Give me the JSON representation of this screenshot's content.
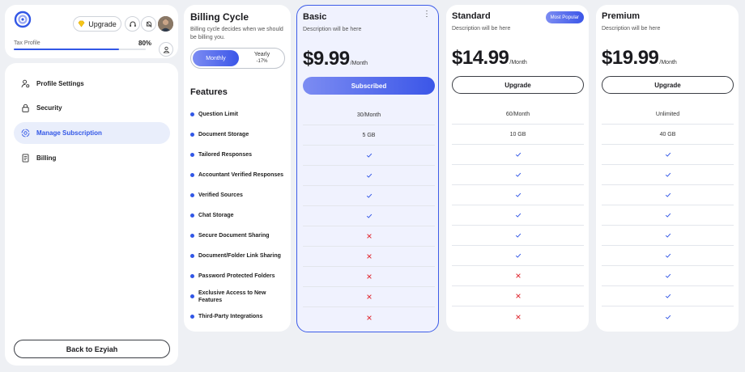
{
  "profile": {
    "upgrade_label": "Upgrade",
    "tax_profile_label": "Tax Profile",
    "tax_profile_percent": "80%",
    "tax_profile_progress": 0.8
  },
  "nav": {
    "items": [
      {
        "label": "Profile Settings",
        "icon": "user-settings-icon"
      },
      {
        "label": "Security",
        "icon": "lock-icon"
      },
      {
        "label": "Manage Subscription",
        "icon": "subscription-icon",
        "active": true
      },
      {
        "label": "Billing",
        "icon": "receipt-icon"
      }
    ],
    "back_label": "Back to Ezyiah"
  },
  "billing": {
    "title": "Billing Cycle",
    "description": "Billing cycle decides when we should be billing you.",
    "monthly_label": "Monthly",
    "yearly_label": "Yearly",
    "yearly_discount": "-17%",
    "selected": "Monthly"
  },
  "features": {
    "title": "Features",
    "items": [
      "Question Limit",
      "Document Storage",
      "Tailored Responses",
      "Accountant Verified Responses",
      "Verified Sources",
      "Chat Storage",
      "Secure Document Sharing",
      "Document/Folder Link Sharing",
      "Password Protected Folders",
      "Exclusive Access to New Features",
      "Third-Party Integrations"
    ]
  },
  "plans": [
    {
      "name": "Basic",
      "description": "Description will be here",
      "price": "$9.99",
      "unit": "/Month",
      "button": "Subscribed",
      "values": [
        "30/Month",
        "5 GB",
        "check",
        "check",
        "check",
        "check",
        "cross",
        "cross",
        "cross",
        "cross",
        "cross"
      ]
    },
    {
      "name": "Standard",
      "description": "Description will be here",
      "badge": "Most Popular",
      "price": "$14.99",
      "unit": "/Month",
      "button": "Upgrade",
      "values": [
        "60/Month",
        "10 GB",
        "check",
        "check",
        "check",
        "check",
        "check",
        "check",
        "cross",
        "cross",
        "cross"
      ]
    },
    {
      "name": "Premium",
      "description": "Description will be here",
      "price": "$19.99",
      "unit": "/Month",
      "button": "Upgrade",
      "values": [
        "Unlimited",
        "40 GB",
        "check",
        "check",
        "check",
        "check",
        "check",
        "check",
        "check",
        "check",
        "check"
      ]
    }
  ],
  "colors": {
    "accent": "#3257e6",
    "check": "#3257e6",
    "cross": "#e0323a"
  }
}
